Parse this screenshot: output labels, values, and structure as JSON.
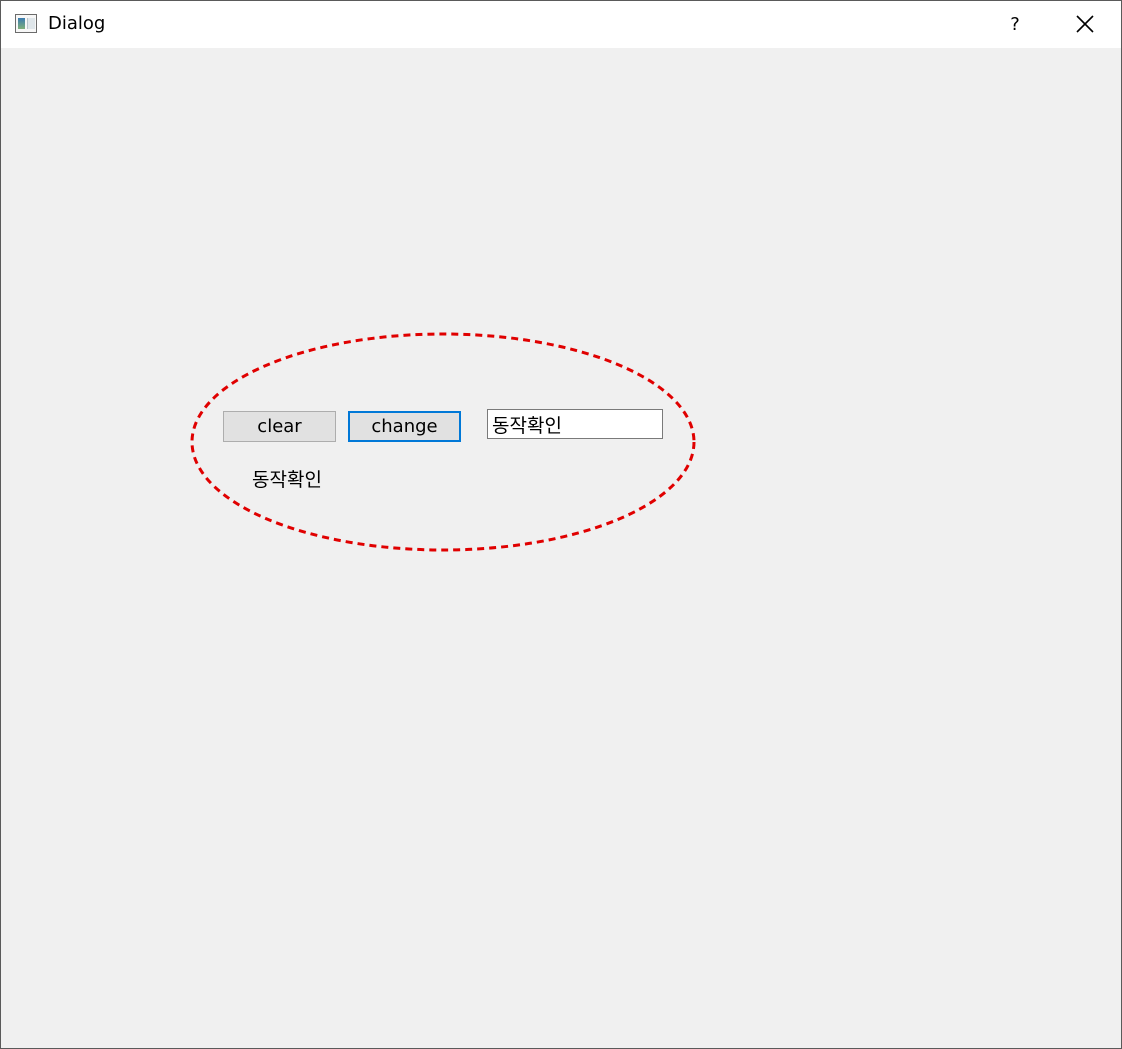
{
  "window": {
    "title": "Dialog",
    "help_label": "?",
    "icon": "dialog-window-icon",
    "close_icon": "close-icon"
  },
  "controls": {
    "clear_label": "clear",
    "change_label": "change",
    "input_value": "동작확인",
    "status_text": "동작확인"
  },
  "colors": {
    "client_background": "#f0f0f0",
    "titlebar_background": "#ffffff",
    "focus_border": "#0078d7",
    "annotation_stroke": "#e00000"
  }
}
